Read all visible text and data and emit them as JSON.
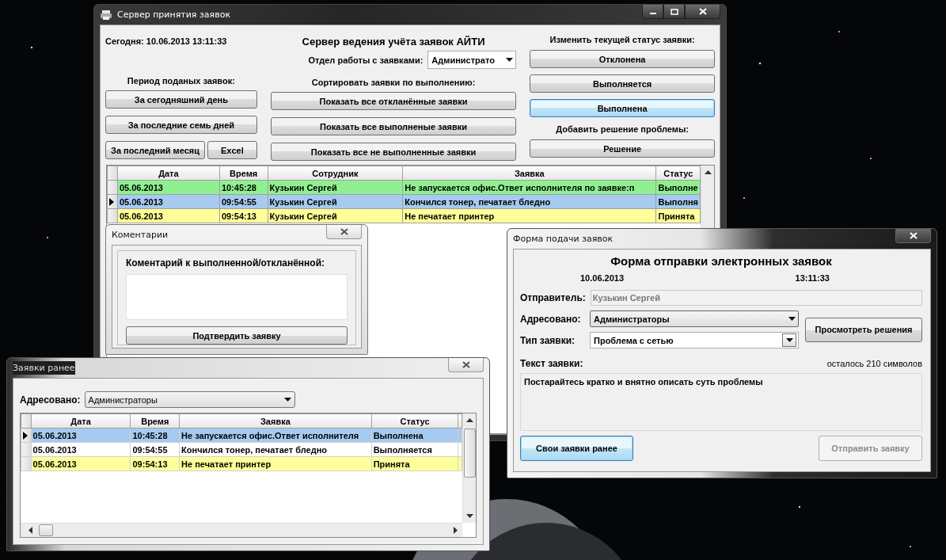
{
  "main_window": {
    "title": "Сервер принятия заявок",
    "today": "Сегодня: 10.06.2013 13:11:33",
    "heading": "Сервер ведения учёта заявок АЙТИ",
    "department_label": "Отдел работы с заявками:",
    "department_value": "Администрато",
    "period_label": "Период поданых заявок:",
    "period_button_rows": [
      {
        "buttons": [
          "За сегодняшний день"
        ]
      },
      {
        "buttons": [
          "За последние семь дней"
        ]
      },
      {
        "buttons": [
          "За последний месяц",
          "Excel"
        ]
      }
    ],
    "sort_label": "Сортировать заявки по выполнению:",
    "sort_buttons": [
      "Показать все откланённые заявки",
      "Показать все выполненые заявки",
      "Показать все не выполненные заявки"
    ],
    "status_label": "Изменить текущей статус заявки:",
    "status_buttons": [
      {
        "label": "Отклонена",
        "focused": false
      },
      {
        "label": "Выполняется",
        "focused": false
      },
      {
        "label": "Выполнена",
        "focused": true
      }
    ],
    "solution_label": "Добавить решение проблемы:",
    "solution_button": "Решение",
    "table": {
      "columns": [
        "Дата",
        "Время",
        "Сотрудник",
        "Заявка",
        "Статус"
      ],
      "rows": [
        {
          "selected": false,
          "color": "#90f090",
          "cells": [
            "05.06.2013",
            "10:45:28",
            "Кузькин Сергей",
            "Не запускается офис.Ответ исполнителя по заявке:п",
            "Выполне"
          ]
        },
        {
          "selected": true,
          "color": "#a6caf0",
          "cells": [
            "05.06.2013",
            "09:54:55",
            "Кузькин Сергей",
            "Кончился тонер, печатает бледно",
            "Выполня"
          ]
        },
        {
          "selected": false,
          "color": "#ffff99",
          "cells": [
            "05.06.2013",
            "09:54:13",
            "Кузькин Сергей",
            "Не печатает принтер",
            "Принята"
          ]
        }
      ]
    }
  },
  "comments_window": {
    "title": "Коментарии",
    "label": "Коментарий к выполненной/откланённой:",
    "confirm_button": "Подтвердить заявку"
  },
  "history_window": {
    "title": "Заявки ранее",
    "addressed_label": "Адресовано:",
    "addressed_value": "Администраторы",
    "table": {
      "columns": [
        "Дата",
        "Время",
        "Заявка",
        "Статус"
      ],
      "rows": [
        {
          "selected": true,
          "color": "#a6caf0",
          "cells": [
            "05.06.2013",
            "10:45:28",
            "Не запускается офис.Ответ исполнителя",
            "Выполнена"
          ]
        },
        {
          "selected": false,
          "color": "#ffffff",
          "cells": [
            "05.06.2013",
            "09:54:55",
            "Кончился тонер, печатает бледно",
            "Выполняется"
          ]
        },
        {
          "selected": false,
          "color": "#ffff99",
          "cells": [
            "05.06.2013",
            "09:54:13",
            "Не печатает принтер",
            "Принята"
          ]
        }
      ]
    }
  },
  "form_window": {
    "title": "Форма подачи заявок",
    "heading": "Форма отправки электронных заявок",
    "date": "10.06.2013",
    "time": "13:11:33",
    "sender_label": "Отправитель:",
    "sender": {
      "value": "Кузькин Сергей",
      "disabled": true
    },
    "addressed_label": "Адресовано:",
    "addressed_value": "Администраторы",
    "type_label": "Тип заявки:",
    "type_value": "Проблема с сетью",
    "solutions_button": "Просмотреть решения",
    "text_label": "Текст заявки:",
    "remaining": "осталось 210 символов",
    "text_value": "Постарайтесь кратко и внятно описать суть проблемы",
    "buttons": [
      {
        "label": "Свои заявки ранее",
        "focused": true,
        "disabled": false
      },
      {
        "label": "Отправить заявку",
        "focused": false,
        "disabled": true
      }
    ]
  }
}
